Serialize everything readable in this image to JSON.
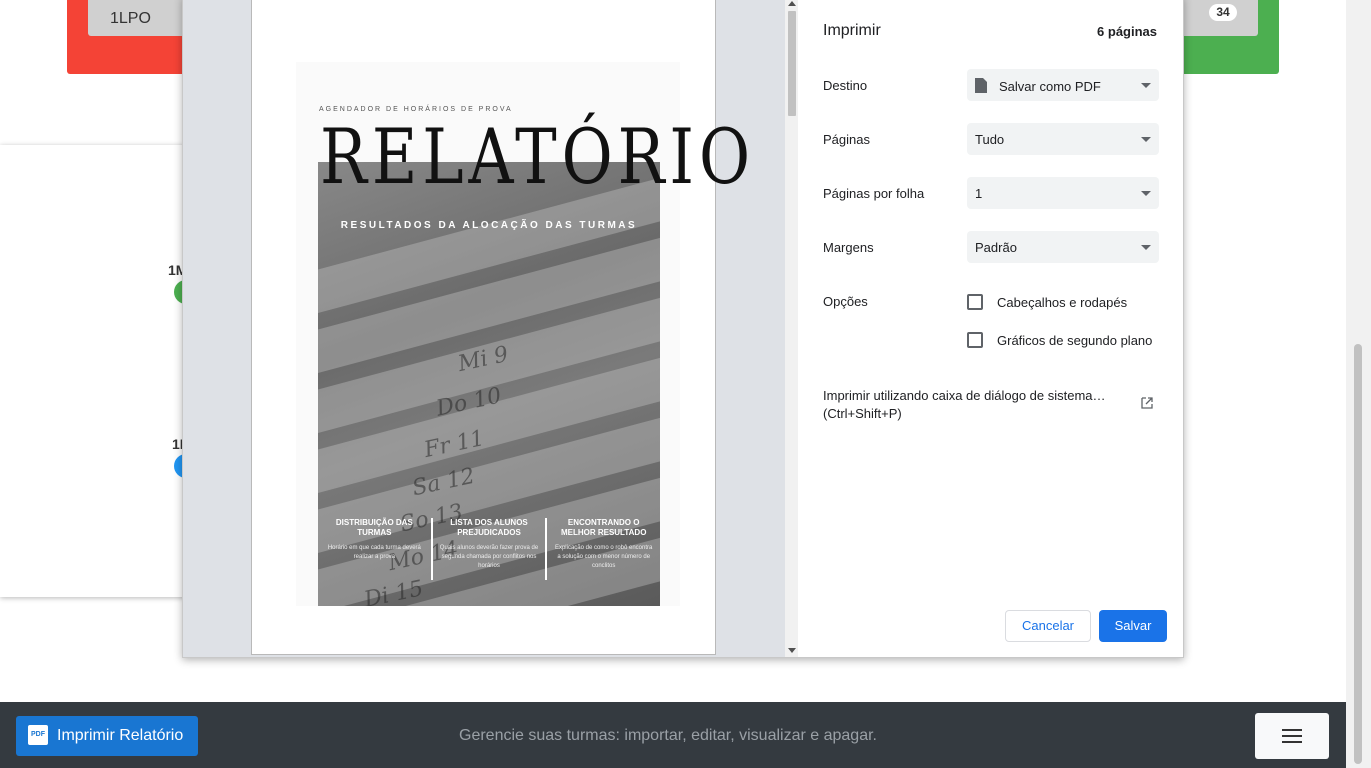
{
  "background": {
    "chip_left_label": "1LPO",
    "badge_count": "34",
    "label_1": "1M",
    "label_2": "1I",
    "colors": {
      "red": "#f44336",
      "green": "#4caf50",
      "blue": "#2196f3"
    }
  },
  "print_dialog": {
    "title": "Imprimir",
    "page_count": "6 páginas",
    "rows": {
      "destination": {
        "label": "Destino",
        "value": "Salvar como PDF"
      },
      "pages": {
        "label": "Páginas",
        "value": "Tudo"
      },
      "pages_per_sheet": {
        "label": "Páginas por folha",
        "value": "1"
      },
      "margins": {
        "label": "Margens",
        "value": "Padrão"
      },
      "options": {
        "label": "Opções"
      }
    },
    "options": {
      "headers_footers": {
        "label": "Cabeçalhos e rodapés",
        "checked": false
      },
      "background_graphics": {
        "label": "Gráficos de segundo plano",
        "checked": false
      }
    },
    "system_dialog_text": "Imprimir utilizando caixa de diálogo de sistema… (Ctrl+Shift+P)",
    "cancel_label": "Cancelar",
    "save_label": "Salvar",
    "accent": "#1a73e8"
  },
  "preview": {
    "subtitle": "AGENDADOR DE HORÁRIOS DE PROVA",
    "title": "RELATÓRIO",
    "heading": "RESULTADOS DA ALOCAÇÃO DAS TURMAS",
    "calendar_marks": [
      "Mi 9",
      "Do 10",
      "Fr 11",
      "Sa 12",
      "So 13",
      "Mo 14",
      "Di 15"
    ],
    "columns": [
      {
        "title": "DISTRIBUIÇÃO DAS TURMAS",
        "desc": "Horário em que cada turma deverá realizar a prova"
      },
      {
        "title": "LISTA DOS ALUNOS PREJUDICADOS",
        "desc": "Quais alunos deverão fazer prova de segunda chamada por conflitos nos horários"
      },
      {
        "title": "ENCONTRANDO O MELHOR RESULTADO",
        "desc": "Explicação de como o robô encontra a solução com o menor número de conclitos"
      }
    ]
  },
  "footer": {
    "print_report_label": "Imprimir Relatório",
    "pdf_icon_text": "PDF",
    "tagline": "Gerencie suas turmas: importar, editar, visualizar e apagar.",
    "bar_color": "#343a40",
    "button_color": "#1976d2"
  }
}
